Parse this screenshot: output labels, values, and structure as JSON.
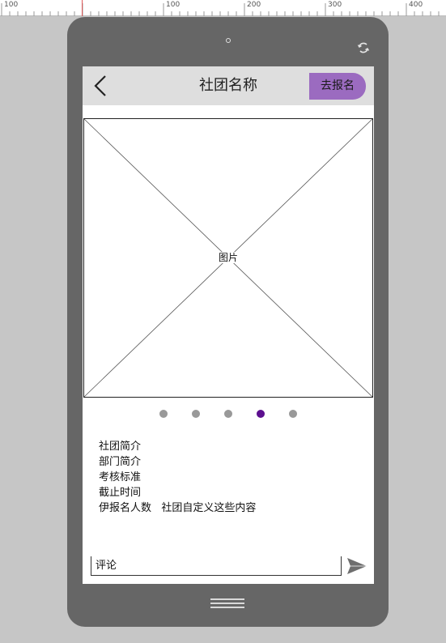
{
  "ruler": {
    "labels": [
      "100",
      "100",
      "200",
      "300",
      "400"
    ]
  },
  "header": {
    "title": "社团名称",
    "signup_label": "去报名"
  },
  "image": {
    "label": "图片"
  },
  "carousel": {
    "count": 5,
    "active_index": 3,
    "colors": {
      "dot": "#999999",
      "active": "#5c0f8f"
    }
  },
  "info": {
    "items": [
      "社团简介",
      "部门简介",
      "考核标准",
      "截止时间",
      "伊报名人数   社团自定义这些内容"
    ]
  },
  "comment": {
    "placeholder": "评论"
  },
  "colors": {
    "accent": "#9b6bc0",
    "phone_frame": "#666666",
    "header_bg": "#dedede",
    "canvas": "#c6c6c6"
  },
  "icons": {
    "back": "chevron-left-icon",
    "rotate": "rotate-icon",
    "send": "send-icon",
    "home": "menu-lines-icon"
  }
}
